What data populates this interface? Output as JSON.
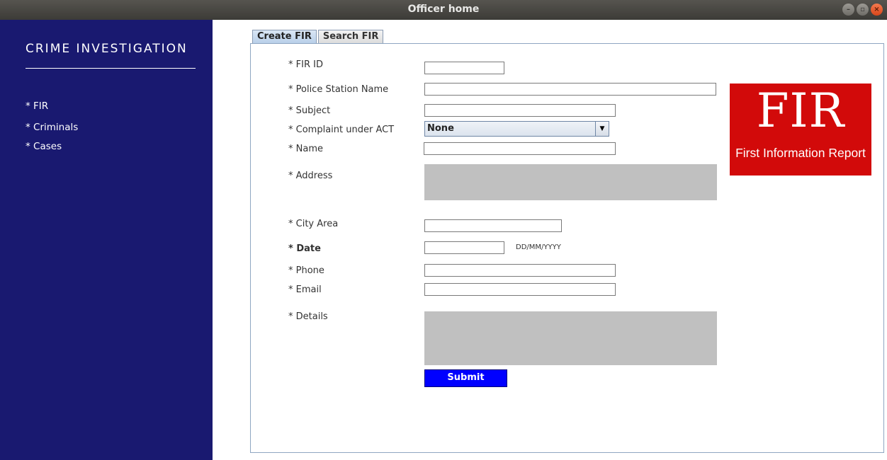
{
  "window": {
    "title": "Officer home",
    "controls": [
      "–",
      "▫",
      "×"
    ]
  },
  "sidebar": {
    "title": "CRIME INVESTIGATION",
    "items": [
      {
        "label": "* FIR"
      },
      {
        "label": "* Criminals"
      },
      {
        "label": "* Cases"
      }
    ]
  },
  "tabs": [
    {
      "label": "Create FIR",
      "active": true
    },
    {
      "label": "Search FIR",
      "active": false
    }
  ],
  "form": {
    "fir_id": {
      "label": "* FIR ID",
      "value": ""
    },
    "police_station": {
      "label": "* Police Station Name",
      "value": ""
    },
    "subject": {
      "label": "* Subject",
      "value": ""
    },
    "complaint_act": {
      "label": "* Complaint under ACT",
      "selected": "None"
    },
    "name": {
      "label": "* Name",
      "value": ""
    },
    "address": {
      "label": "* Address",
      "value": ""
    },
    "city_area": {
      "label": "* City Area",
      "value": ""
    },
    "date": {
      "label": "* Date",
      "value": "",
      "hint": "DD/MM/YYYY"
    },
    "phone": {
      "label": "* Phone",
      "value": ""
    },
    "email": {
      "label": "* Email",
      "value": ""
    },
    "details": {
      "label": "* Details",
      "value": ""
    },
    "submit_label": "Submit"
  },
  "logo": {
    "big": "FIR",
    "small": "First Information Report",
    "color": "#d20a0a"
  },
  "colors": {
    "sidebar": "#191970",
    "submit": "#0000ff",
    "textarea": "#c0c0c0"
  }
}
